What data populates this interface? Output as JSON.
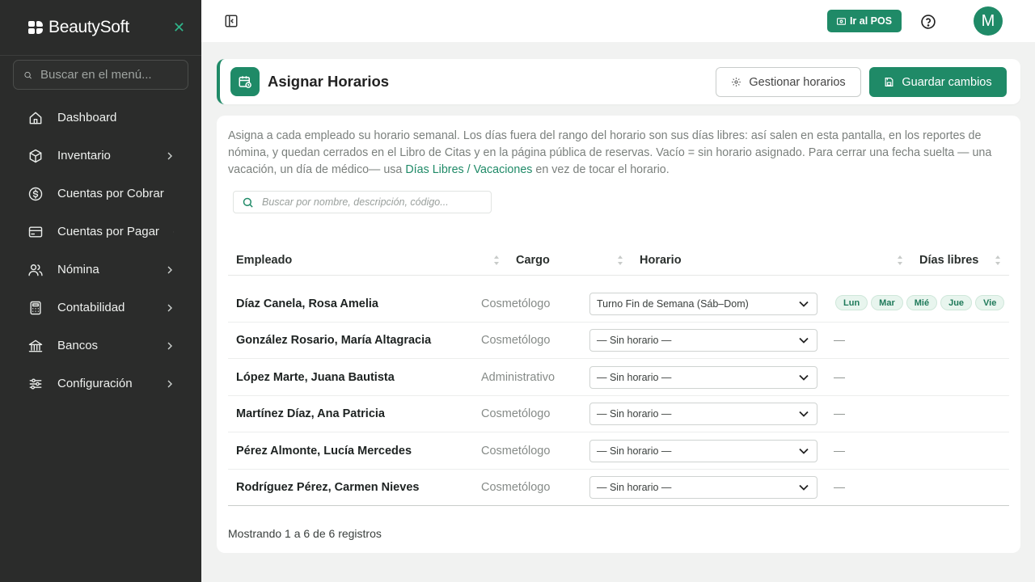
{
  "app": {
    "brand": "BeautySoft"
  },
  "sidebar": {
    "search_placeholder": "Buscar en el menú...",
    "items": [
      {
        "label": "Dashboard",
        "icon": "home-icon",
        "has_chevron": false
      },
      {
        "label": "Inventario",
        "icon": "box-icon",
        "has_chevron": true
      },
      {
        "label": "Cuentas por Cobrar",
        "icon": "dollar-circle-icon",
        "has_chevron": true
      },
      {
        "label": "Cuentas por Pagar",
        "icon": "credit-card-icon",
        "has_chevron": true
      },
      {
        "label": "Nómina",
        "icon": "users-icon",
        "has_chevron": true
      },
      {
        "label": "Contabilidad",
        "icon": "calculator-icon",
        "has_chevron": true
      },
      {
        "label": "Bancos",
        "icon": "bank-icon",
        "has_chevron": true
      },
      {
        "label": "Configuración",
        "icon": "sliders-icon",
        "has_chevron": true
      }
    ]
  },
  "topbar": {
    "pos_label": "Ir al POS",
    "avatar_initial": "M"
  },
  "header": {
    "title": "Asignar Horarios",
    "manage_label": "Gestionar horarios",
    "save_label": "Guardar cambios"
  },
  "main": {
    "description_before": "Asigna a cada empleado su horario semanal. Los días fuera del rango del horario son sus días libres: así salen en esta pantalla, en los reportes de nómina, y quedan cerrados en el Libro de Citas y en la página pública de reservas. Vacío = sin horario asignado. Para cerrar una fecha suelta — una vacación, un día de médico— usa ",
    "description_link": "Días Libres / Vacaciones",
    "description_after": " en vez de tocar el horario.",
    "search_placeholder": "Buscar por nombre, descripción, código...",
    "columns": {
      "empleado": "Empleado",
      "cargo": "Cargo",
      "horario": "Horario",
      "dias_libres": "Días libres"
    },
    "rows": [
      {
        "name": "Díaz Canela, Rosa Amelia",
        "cargo": "Cosmetólogo",
        "horario": "Turno Fin de Semana (Sáb–Dom)",
        "dias_libres": [
          "Lun",
          "Mar",
          "Mié",
          "Jue",
          "Vie"
        ]
      },
      {
        "name": "González Rosario, María Altagracia",
        "cargo": "Cosmetólogo",
        "horario": "— Sin horario —",
        "dias_libres": "—"
      },
      {
        "name": "López Marte, Juana Bautista",
        "cargo": "Administrativo",
        "horario": "— Sin horario —",
        "dias_libres": "—"
      },
      {
        "name": "Martínez Díaz, Ana Patricia",
        "cargo": "Cosmetólogo",
        "horario": "— Sin horario —",
        "dias_libres": "—"
      },
      {
        "name": "Pérez Almonte, Lucía Mercedes",
        "cargo": "Cosmetólogo",
        "horario": "— Sin horario —",
        "dias_libres": "—"
      },
      {
        "name": "Rodríguez Pérez, Carmen Nieves",
        "cargo": "Cosmetólogo",
        "horario": "— Sin horario —",
        "dias_libres": "—"
      }
    ],
    "footer": "Mostrando 1 a 6 de 6 registros"
  },
  "colors": {
    "accent": "#1f8a67",
    "sidebar_bg": "#2b2c2b",
    "page_bg": "#f1f2f1"
  }
}
